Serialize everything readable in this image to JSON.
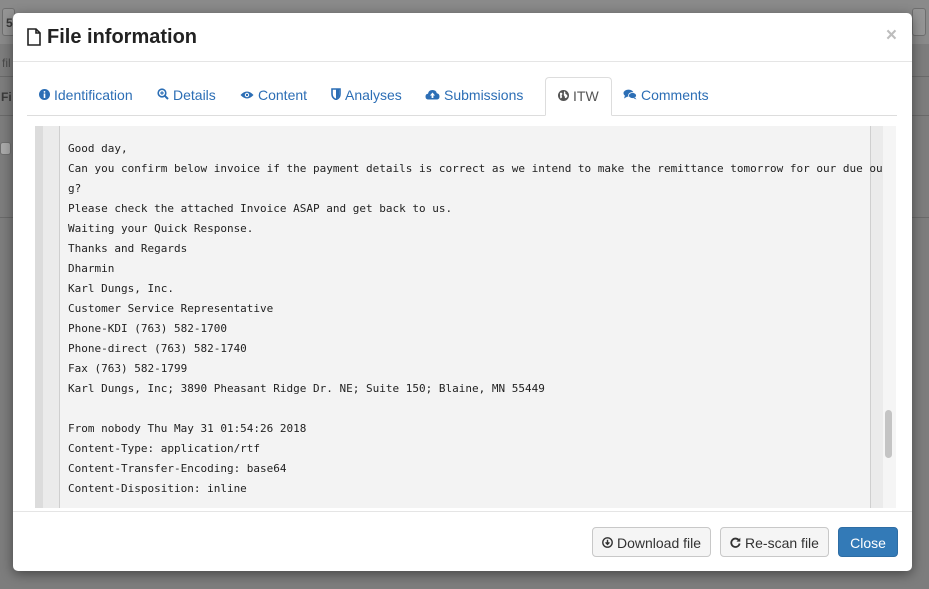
{
  "background": {
    "left_snippets": [
      "5",
      "fil",
      "Fi"
    ]
  },
  "modal": {
    "title": "File information",
    "close_symbol": "×"
  },
  "tabs": [
    {
      "label": "Identification",
      "icon": "info-icon"
    },
    {
      "label": "Details",
      "icon": "zoom-icon"
    },
    {
      "label": "Content",
      "icon": "eye-icon"
    },
    {
      "label": "Analyses",
      "icon": "shield-icon"
    },
    {
      "label": "Submissions",
      "icon": "cloud-upload-icon"
    },
    {
      "label": "ITW",
      "icon": "globe-icon",
      "active": true
    },
    {
      "label": "Comments",
      "icon": "comments-icon"
    }
  ],
  "content": {
    "lines": [
      "Good day,",
      "Can you confirm below invoice if the payment details is correct as we intend to make the remittance tomorrow for our due outstandin",
      "g?",
      "Please check the attached Invoice ASAP and get back to us.",
      "Waiting your Quick Response.",
      "Thanks and Regards",
      "Dharmin",
      "Karl Dungs, Inc.",
      "Customer Service Representative",
      "Phone-KDI (763) 582-1700",
      "Phone-direct (763) 582-1740",
      "Fax (763) 582-1799",
      "Karl Dungs, Inc; 3890 Pheasant Ridge Dr. NE; Suite 150; Blaine, MN 55449",
      "",
      "From nobody Thu May 31 01:54:26 2018",
      "Content-Type: application/rtf",
      "Content-Transfer-Encoding: base64",
      "Content-Disposition: inline"
    ]
  },
  "footer": {
    "download_label": "Download file",
    "rescan_label": "Re-scan file",
    "close_label": "Close"
  },
  "colors": {
    "link": "#2c6eb5",
    "primary": "#337ab7",
    "overlay": "#7d7d7d"
  }
}
